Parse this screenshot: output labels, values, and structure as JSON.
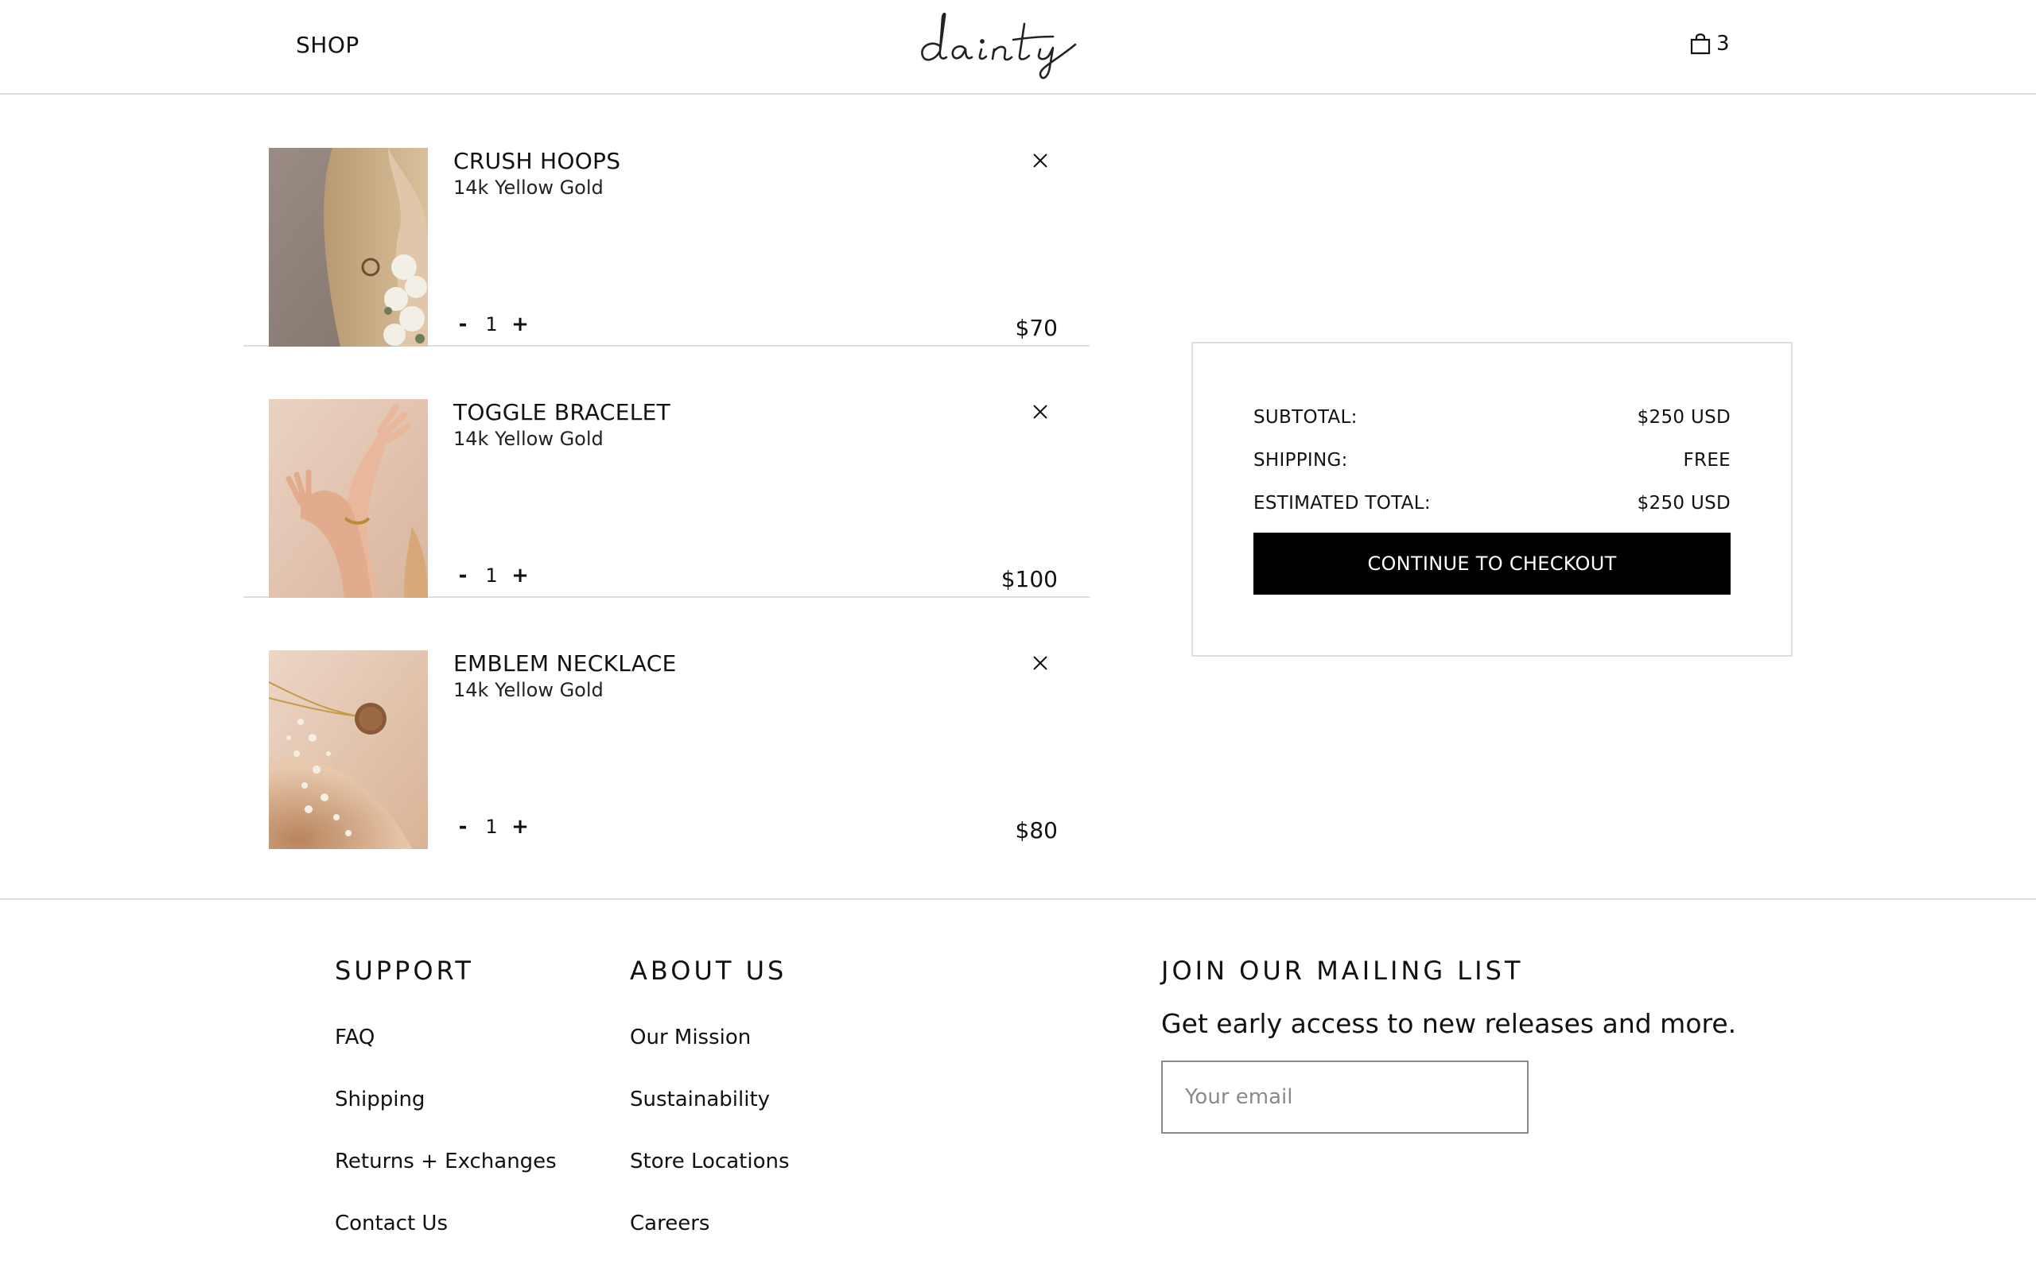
{
  "header": {
    "shop_label": "SHOP",
    "logo_text": "dainty",
    "cart_count": "3"
  },
  "cart": {
    "items": [
      {
        "name": "CRUSH HOOPS",
        "variant": "14k Yellow Gold",
        "quantity": "1",
        "price": "$70",
        "minus": "-",
        "plus": "+",
        "remove": "×"
      },
      {
        "name": "TOGGLE BRACELET",
        "variant": "14k Yellow Gold",
        "quantity": "1",
        "price": "$100",
        "minus": "-",
        "plus": "+",
        "remove": "×"
      },
      {
        "name": "EMBLEM NECKLACE",
        "variant": "14k Yellow Gold",
        "quantity": "1",
        "price": "$80",
        "minus": "-",
        "plus": "+",
        "remove": "×"
      }
    ]
  },
  "summary": {
    "subtotal_label": "SUBTOTAL:",
    "subtotal_value": "$250 USD",
    "shipping_label": "SHIPPING:",
    "shipping_value": "FREE",
    "total_label": "ESTIMATED TOTAL:",
    "total_value": "$250 USD",
    "checkout_label": "CONTINUE TO CHECKOUT"
  },
  "footer": {
    "support": {
      "title": "SUPPORT",
      "links": [
        "FAQ",
        "Shipping",
        "Returns + Exchanges",
        "Contact Us"
      ]
    },
    "about": {
      "title": "ABOUT US",
      "links": [
        "Our Mission",
        "Sustainability",
        "Store Locations",
        "Careers"
      ]
    },
    "mailing": {
      "title": "JOIN OUR MAILING LIST",
      "subtitle": "Get early access to new releases and more.",
      "email_placeholder": "Your email",
      "email_value": ""
    }
  },
  "colors": {
    "border": "#dcdcdc",
    "button_bg": "#000000",
    "button_text": "#ffffff"
  }
}
